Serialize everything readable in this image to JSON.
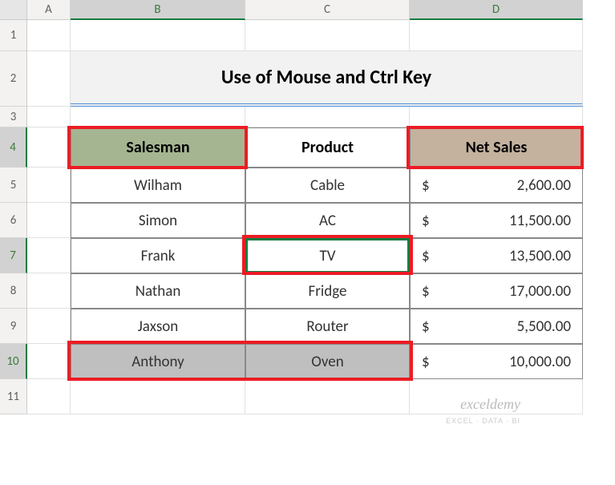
{
  "columns": [
    "A",
    "B",
    "C",
    "D"
  ],
  "rows": [
    "1",
    "2",
    "3",
    "4",
    "5",
    "6",
    "7",
    "8",
    "9",
    "10",
    "11"
  ],
  "title": "Use of Mouse and Ctrl Key",
  "headers": {
    "b": "Salesman",
    "c": "Product",
    "d": "Net Sales"
  },
  "data": [
    {
      "salesman": "Wilham",
      "product": "Cable",
      "net": "2,600.00"
    },
    {
      "salesman": "Simon",
      "product": "AC",
      "net": "11,500.00"
    },
    {
      "salesman": "Frank",
      "product": "TV",
      "net": "13,500.00"
    },
    {
      "salesman": "Nathan",
      "product": "Fridge",
      "net": "17,000.00"
    },
    {
      "salesman": "Jaxson",
      "product": "Router",
      "net": "5,500.00"
    },
    {
      "salesman": "Anthony",
      "product": "Oven",
      "net": "10,000.00"
    }
  ],
  "currency": "$",
  "watermark": "exceldemy",
  "watermark_sub": "EXCEL · DATA · BI",
  "selected_columns": [
    "B",
    "D"
  ],
  "selected_rows": [
    "4",
    "7",
    "10"
  ],
  "active_cell": "C7"
}
